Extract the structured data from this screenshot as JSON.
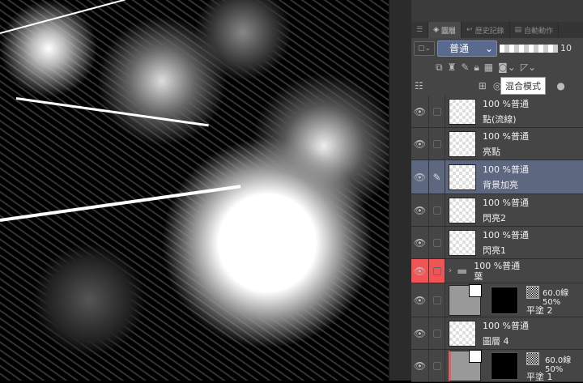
{
  "tabs": [
    {
      "label": "圖層"
    },
    {
      "label": "歷史記錄"
    },
    {
      "label": "自動動作"
    }
  ],
  "blend_mode": "普通",
  "opacity_value": "10",
  "tooltip": "混合模式",
  "layers": [
    {
      "name": "點(流線)",
      "info": "100 %普通"
    },
    {
      "name": "亮點",
      "info": "100 %普通"
    },
    {
      "name": "背景加亮",
      "info": "100 %普通",
      "selected": true
    },
    {
      "name": "閃亮2",
      "info": "100 %普通"
    },
    {
      "name": "閃亮1",
      "info": "100 %普通"
    },
    {
      "name": "葉",
      "info": "100 %普通",
      "folder": true
    },
    {
      "name": "平塗 2",
      "info": "60.0線 50%"
    },
    {
      "name": "圖層 4",
      "info": "100 %普通"
    },
    {
      "name": "平塗 1",
      "info": "60.0線 50%"
    }
  ]
}
